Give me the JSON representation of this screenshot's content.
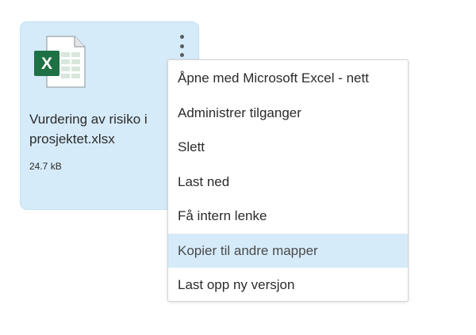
{
  "file": {
    "name_line1": "Vurdering av risiko i",
    "name_line2": "prosjektet.xlsx",
    "size": "24.7 kB",
    "icon": "excel-file-icon",
    "icon_letter": "X"
  },
  "context_menu": {
    "items": [
      {
        "label": "Åpne med Microsoft Excel - nett"
      },
      {
        "label": "Administrer tilganger"
      },
      {
        "label": "Slett"
      },
      {
        "label": "Last ned"
      },
      {
        "label": "Få intern lenke"
      },
      {
        "label": "Kopier til andre mapper",
        "highlighted": true
      },
      {
        "label": "Last opp ny versjon"
      }
    ]
  },
  "colors": {
    "card_background": "#d6ebf9",
    "highlight": "#d6ebf9",
    "excel_green": "#1e7145"
  }
}
